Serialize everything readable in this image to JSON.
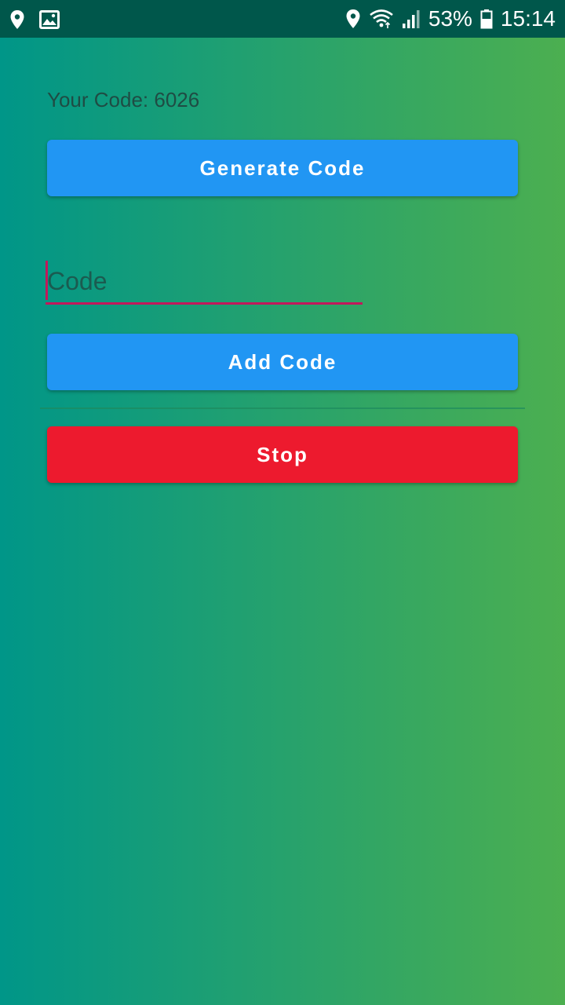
{
  "status_bar": {
    "battery_percent": "53%",
    "time": "15:14",
    "icons_left": [
      "location-icon",
      "image-icon"
    ],
    "icons_right": [
      "location-icon",
      "wifi-icon",
      "signal-icon",
      "battery-icon"
    ]
  },
  "main": {
    "code_label": "Your Code: 6026",
    "generate_button": "Generate Code",
    "code_input": {
      "placeholder": "Code",
      "value": ""
    },
    "add_button": "Add Code",
    "stop_button": "Stop"
  },
  "colors": {
    "status_bar": "#00574b",
    "gradient_start": "#009688",
    "gradient_end": "#4caf50",
    "primary_button": "#2196f3",
    "stop_button": "#ed1a2e",
    "input_accent": "#c2185b"
  }
}
